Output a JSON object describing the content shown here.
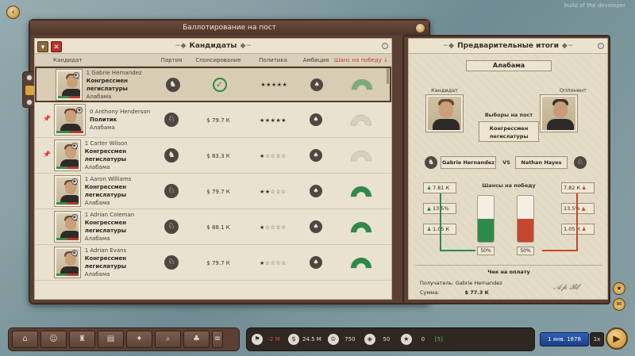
{
  "top": {
    "title": "Баллотирование на пост",
    "build_label": "build of the developer"
  },
  "candidates_panel": {
    "title": "Кандидаты",
    "columns": {
      "candidate": "Кандидат",
      "party": "Партия",
      "sponsorship": "Спонсирование",
      "policy": "Политика",
      "ambition": "Амбиция",
      "win_chance": "Шанс на победу ↓"
    },
    "rows": [
      {
        "name": "1 Gabrie Hernandez",
        "job": "Конгрессмен легислатуры",
        "state": "Алабама",
        "party_icon": "elephant-icon",
        "sponsored": true,
        "funding": "",
        "stars": "★★★★★",
        "chance": 0.55,
        "chance_color": "#2e8a4a"
      },
      {
        "name": "0 Anthony Henderson",
        "job": "Политик",
        "state": "Алабама",
        "party_icon": "donkey-icon",
        "sponsored": false,
        "funding": "$ 79.7 К",
        "stars": "★★★★★",
        "chance": 0.0,
        "chance_color": "#2e8a4a"
      },
      {
        "name": "1 Carter Wilson",
        "job": "Конгрессмен легислатуры",
        "state": "Алабама",
        "party_icon": "elephant-icon",
        "sponsored": false,
        "funding": "$ 83.3 К",
        "stars": "★☆☆☆☆",
        "chance": 0.0,
        "chance_color": "#2e8a4a"
      },
      {
        "name": "1 Aaron Williams",
        "job": "Конгрессмен легислатуры",
        "state": "Алабама",
        "party_icon": "donkey-icon",
        "sponsored": false,
        "funding": "$ 79.7 К",
        "stars": "★★☆☆☆",
        "chance": 1.0,
        "chance_color": "#2e8a4a"
      },
      {
        "name": "1 Adrian Coleman",
        "job": "Конгрессмен легислатуры",
        "state": "Алабама",
        "party_icon": "donkey-icon",
        "sponsored": false,
        "funding": "$ 88.1 К",
        "stars": "★☆☆☆☆",
        "chance": 1.0,
        "chance_color": "#2e8a4a"
      },
      {
        "name": "1 Adrian Evans",
        "job": "Конгрессмен легислатуры",
        "state": "Алабама",
        "party_icon": "donkey-icon",
        "sponsored": false,
        "funding": "$ 79.7 К",
        "stars": "★☆☆☆☆",
        "chance": 1.0,
        "chance_color": "#2e8a4a"
      }
    ]
  },
  "results_panel": {
    "title": "Предварительные итоги",
    "state": "Алабама",
    "candidate_label": "Кандидат",
    "opponent_label": "Оппонент",
    "election_label": "Выборы на пост",
    "office": "Конгрессмен легислатуры",
    "candidate_name": "Gabrie Hernandez",
    "vs": "VS",
    "opponent_name": "Nathan Hayes",
    "win_chances_label": "Шансы на победу",
    "left_stats": [
      "7.81 К",
      "13.5%",
      "1.05 К"
    ],
    "right_stats": [
      "7.82 К",
      "13.5%",
      "1.05 К"
    ],
    "left_pct": "50%",
    "right_pct": "50%",
    "left_share": 0.5,
    "right_share": 0.5,
    "receipt_title": "Чек на оплату",
    "recipient_label": "Получатель: Gabrie Hernandez",
    "sum_label": "Сумма:",
    "sum_value": "$ 77.3 К"
  },
  "bottom": {
    "stats": [
      {
        "icon": "flag-icon",
        "value": "-2 М",
        "tone": "neg"
      },
      {
        "icon": "dollar-icon",
        "value": "24.5 М",
        "tone": "normal"
      },
      {
        "icon": "crown-icon",
        "value": "750",
        "tone": "normal"
      },
      {
        "icon": "map-icon",
        "value": "50",
        "tone": "normal"
      },
      {
        "icon": "star-icon",
        "value": "0",
        "extra": "[5]",
        "tone": "normal"
      }
    ],
    "date": "1 янв. 1878",
    "speed": "1x"
  },
  "colors": {
    "green": "#2e8a4a",
    "red": "#c7462f",
    "accent_gold": "#d9a441"
  }
}
